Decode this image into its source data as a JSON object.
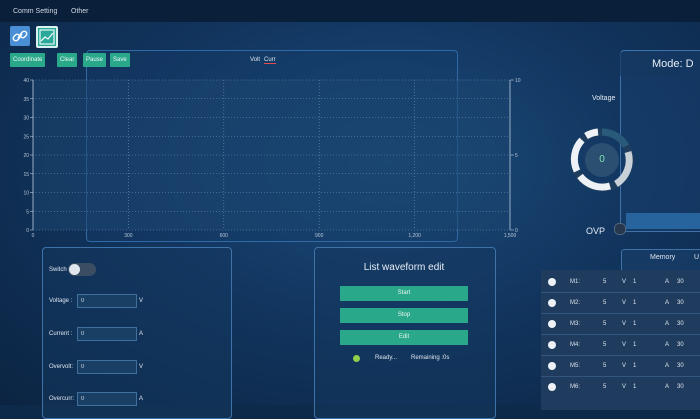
{
  "menu": {
    "items": [
      "Comm Setting",
      "Other"
    ]
  },
  "toolbar": {
    "link_icon": "link-icon",
    "chart_icon": "chart-edit-icon"
  },
  "chart_buttons": {
    "coordinate": "Coordinate",
    "clear": "Clear",
    "pause": "Pause",
    "save": "Save"
  },
  "legend": {
    "volt": "Volt",
    "curr": "Curr"
  },
  "chart_data": {
    "type": "line",
    "x_ticks": [
      "0",
      "300",
      "600",
      "900",
      "1,200",
      "1,500"
    ],
    "y_left_ticks": [
      "0",
      "5",
      "10",
      "15",
      "20",
      "25",
      "30",
      "35",
      "40"
    ],
    "y_right_ticks": [
      "0",
      "5",
      "10"
    ],
    "xlim": [
      0,
      1500
    ],
    "ylim_left": [
      0,
      40
    ],
    "ylim_right": [
      0,
      10
    ],
    "series": [
      {
        "name": "Volt",
        "values": []
      },
      {
        "name": "Curr",
        "values": []
      }
    ],
    "grid": true
  },
  "mode": {
    "label": "Mode: D"
  },
  "gauge": {
    "title": "Voltage",
    "value": "0"
  },
  "ovp": {
    "label": "OVP"
  },
  "controls": {
    "switch_label": "Switch",
    "voltage": {
      "label": "Voltage :",
      "value": "0",
      "unit": "V"
    },
    "current": {
      "label": "Current :",
      "value": "0",
      "unit": "A"
    },
    "overvolt": {
      "label": "Overvolt:",
      "value": "0",
      "unit": "V"
    },
    "overcurr": {
      "label": "Overcurr:",
      "value": "0",
      "unit": "A"
    }
  },
  "list_waveform": {
    "title": "List waveform edit",
    "start": "Start",
    "stop": "Stop",
    "edit": "Edit",
    "status": "Ready...",
    "remaining": "Remaining :0s"
  },
  "memory": {
    "header": "Memory",
    "header2": "U",
    "rows": [
      {
        "name": "M1:",
        "v": "5",
        "vu": "V",
        "a": "1",
        "au": "A",
        "t": "30"
      },
      {
        "name": "M2:",
        "v": "5",
        "vu": "V",
        "a": "1",
        "au": "A",
        "t": "30"
      },
      {
        "name": "M3:",
        "v": "5",
        "vu": "V",
        "a": "1",
        "au": "A",
        "t": "30"
      },
      {
        "name": "M4:",
        "v": "5",
        "vu": "V",
        "a": "1",
        "au": "A",
        "t": "30"
      },
      {
        "name": "M5:",
        "v": "5",
        "vu": "V",
        "a": "1",
        "au": "A",
        "t": "30"
      },
      {
        "name": "M6:",
        "v": "5",
        "vu": "V",
        "a": "1",
        "au": "A",
        "t": "30"
      }
    ]
  },
  "colors": {
    "accent": "#2aa88a",
    "background": "#123660",
    "gauge_value": "#7fe2b2"
  }
}
